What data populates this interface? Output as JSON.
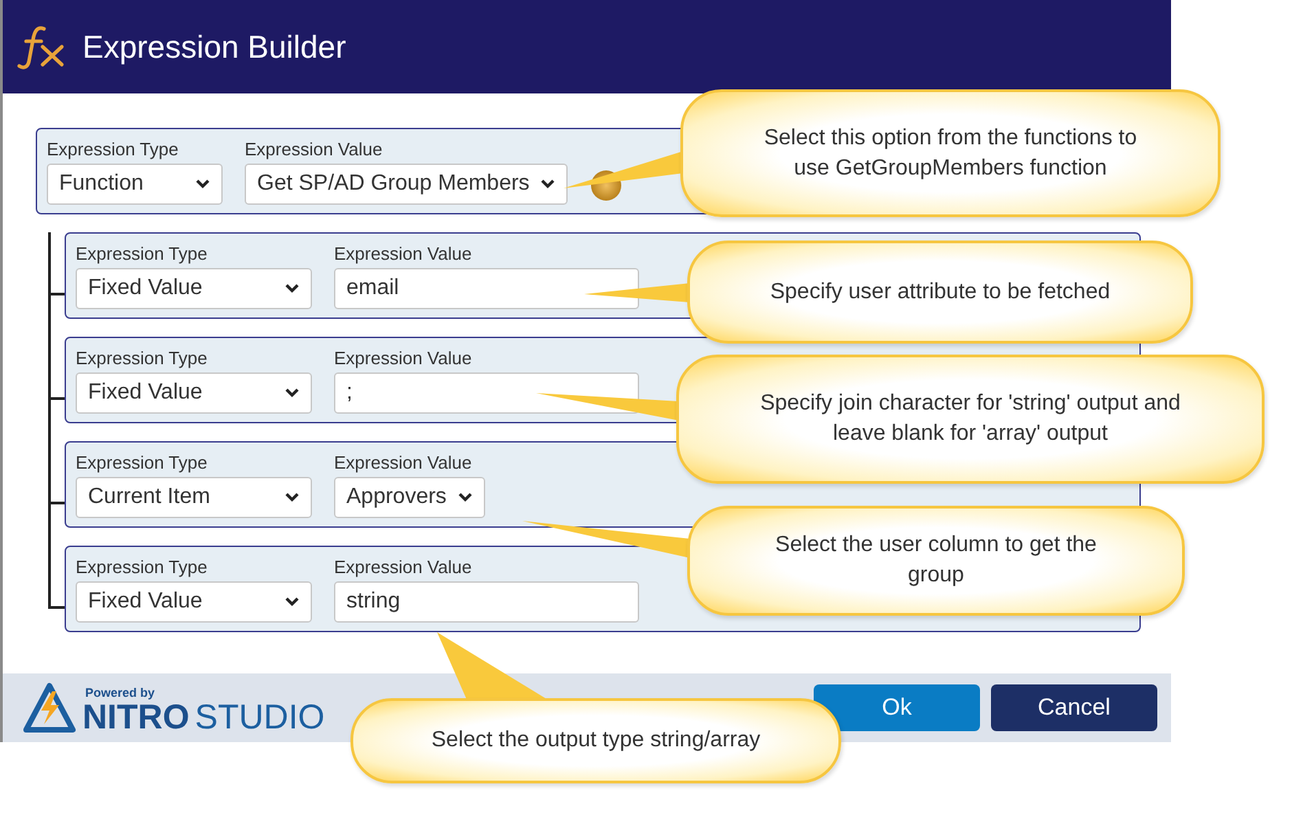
{
  "window": {
    "title": "Expression Builder"
  },
  "expression": {
    "type_label": "Expression Type",
    "type": "Function",
    "value_label": "Expression Value",
    "value": {
      "kind": "select",
      "text": "Get SP/AD Group Members"
    }
  },
  "arguments": [
    {
      "type_label": "Expression Type",
      "type": "Fixed Value",
      "value_label": "Expression Value",
      "value": {
        "kind": "text",
        "text": "email"
      }
    },
    {
      "type_label": "Expression Type",
      "type": "Fixed Value",
      "value_label": "Expression Value",
      "value": {
        "kind": "text",
        "text": ";"
      }
    },
    {
      "type_label": "Expression Type",
      "type": "Current Item",
      "value_label": "Expression Value",
      "value": {
        "kind": "select",
        "text": "Approvers"
      }
    },
    {
      "type_label": "Expression Type",
      "type": "Fixed Value",
      "value_label": "Expression Value",
      "value": {
        "kind": "text",
        "text": "string"
      }
    }
  ],
  "footer": {
    "powered_by": "Powered by",
    "brand_bold": "NITRO",
    "brand_light": "STUDIO",
    "buttons": [
      {
        "label": "Ok",
        "kind": "primary"
      },
      {
        "label": "Cancel",
        "kind": "secondary"
      }
    ]
  },
  "callouts": [
    {
      "text": "Select this option from the functions to\nuse GetGroupMembers function"
    },
    {
      "text": "Specify user attribute to be fetched"
    },
    {
      "text": "Specify join character for 'string' output and\nleave blank for 'array' output"
    },
    {
      "text": "Select the user column to get the\ngroup"
    },
    {
      "text": "Select the output type string/array"
    }
  ]
}
